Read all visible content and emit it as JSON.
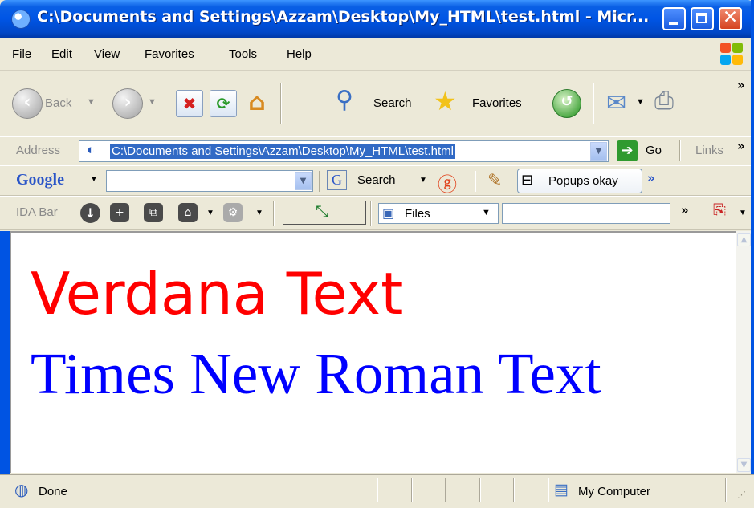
{
  "window": {
    "title": "C:\\Documents and Settings\\Azzam\\Desktop\\My_HTML\\test.html - Micr...",
    "minimize": "–",
    "maximize": "□",
    "close": "✕"
  },
  "menu": [
    "File",
    "Edit",
    "View",
    "Favorites",
    "Tools",
    "Help"
  ],
  "menu_mnemonics": [
    "F",
    "E",
    "V",
    "a",
    "T",
    "H"
  ],
  "toolbar": {
    "back_label": "Back",
    "search_label": "Search",
    "favorites_label": "Favorites",
    "more": "»"
  },
  "address": {
    "label": "Address",
    "value": "C:\\Documents and Settings\\Azzam\\Desktop\\My_HTML\\test.html",
    "go_label": "Go",
    "links_label": "Links",
    "more": "»"
  },
  "google_bar": {
    "brand": "Google",
    "search_label": "Search",
    "popups_label": "Popups okay",
    "more": "»"
  },
  "ida_bar": {
    "label": "IDA Bar",
    "files_label": "Files",
    "more": "»"
  },
  "page": {
    "verdana_text": "Verdana Text",
    "times_text": "Times New Roman Text",
    "verdana_color": "#FF0000",
    "times_color": "#0000FF"
  },
  "status": {
    "text": "Done",
    "zone": "My Computer"
  }
}
